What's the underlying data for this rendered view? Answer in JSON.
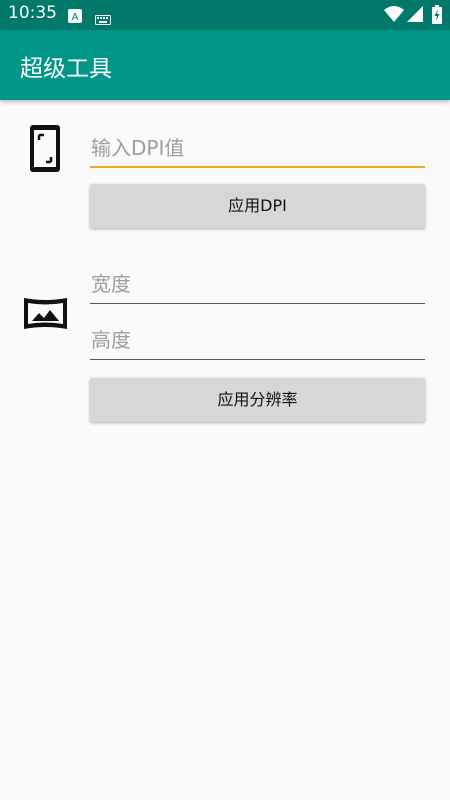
{
  "status_bar": {
    "time": "10:35",
    "icons": [
      "keyboard-a-icon",
      "keyboard-icon",
      "wifi-icon",
      "signal-icon",
      "battery-charging-icon"
    ],
    "keyboard_a_letter": "A"
  },
  "app_bar": {
    "title": "超级工具"
  },
  "dpi_section": {
    "icon": "phone-screen-icon",
    "input_placeholder": "输入DPI值",
    "input_value": "",
    "button_label": "应用DPI"
  },
  "resolution_section": {
    "icon": "panorama-icon",
    "width_placeholder": "宽度",
    "width_value": "",
    "height_placeholder": "高度",
    "height_value": "",
    "button_label": "应用分辨率"
  },
  "colors": {
    "status_bar": "#00796b",
    "app_bar": "#009688",
    "accent": "#f5a623",
    "background": "#fafafa",
    "button": "#d6d7d7"
  }
}
